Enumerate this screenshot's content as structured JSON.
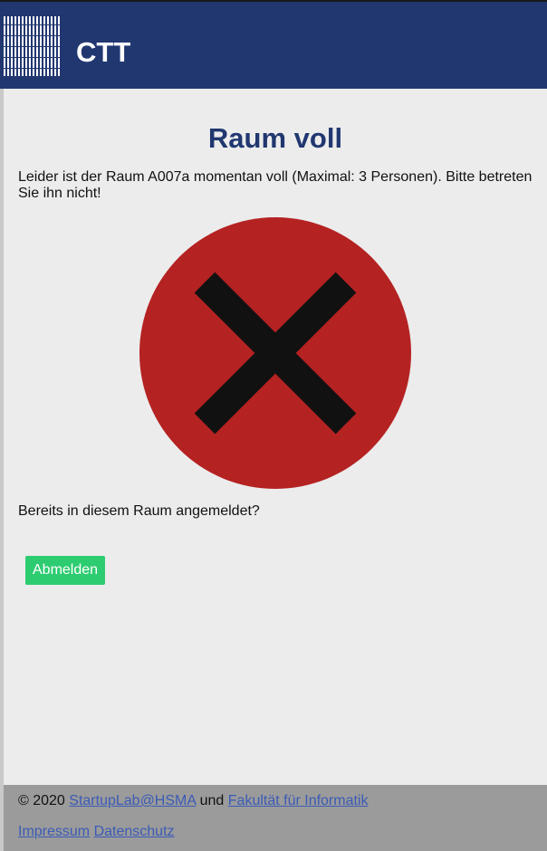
{
  "header": {
    "brand": "CTT",
    "logo_icon": "striped-grid-logo"
  },
  "main": {
    "title": "Raum voll",
    "message": "Leider ist der Raum A007a momentan voll (Maximal: 3 Personen). Bitte betreten Sie ihn nicht!",
    "status_icon": "red-circle-x-icon",
    "already_registered": "Bereits in diesem Raum angemeldet?",
    "logout_label": "Abmelden"
  },
  "footer": {
    "copyright": "© 2020",
    "link_startuplab": "StartupLab@HSMA",
    "conjunction": "und",
    "link_faculty": "Fakultät für Informatik",
    "link_impressum": "Impressum",
    "link_datenschutz": "Datenschutz"
  },
  "colors": {
    "header_bg": "#213770",
    "title": "#213770",
    "deny_circle": "#b52222",
    "deny_cross": "#111111",
    "button_bg": "#2ecc71",
    "footer_bg": "#9b9b9b",
    "link": "#3b5bb5"
  }
}
